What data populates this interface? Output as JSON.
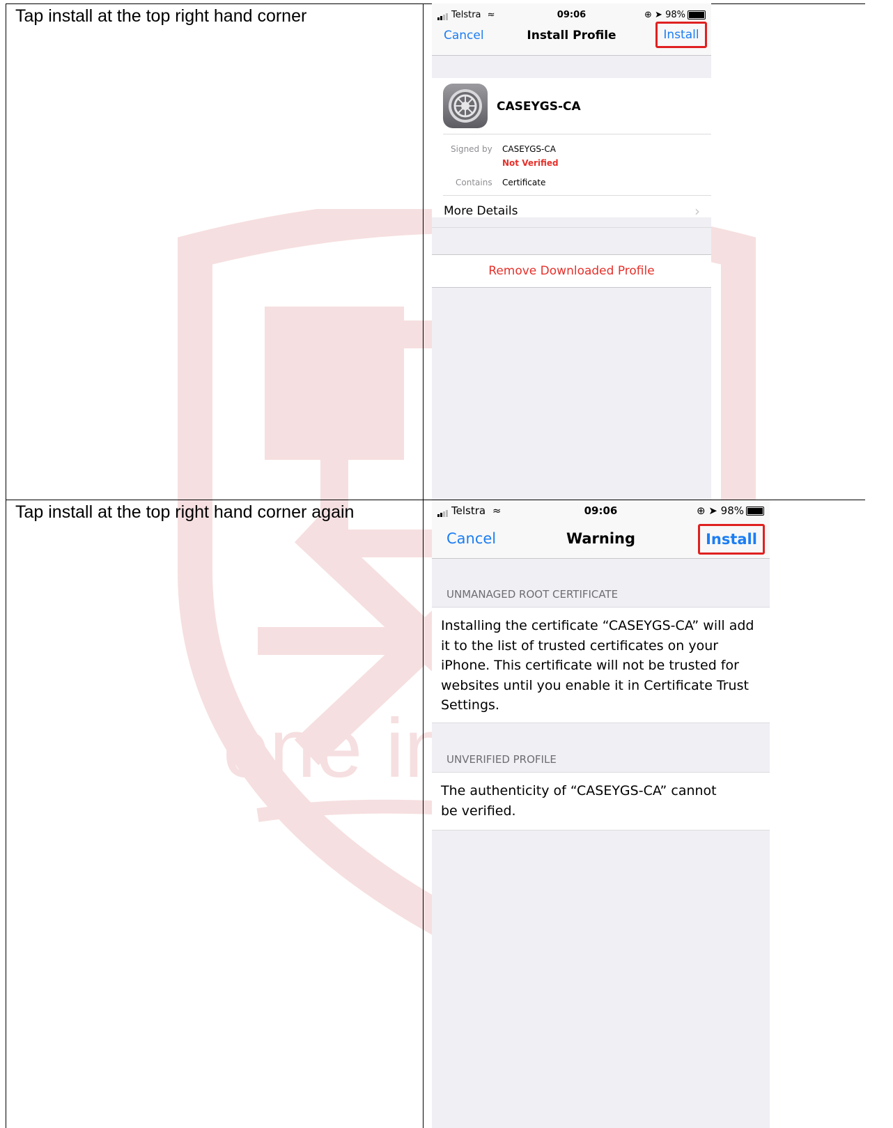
{
  "instructions": {
    "step1": "Tap install at the top right hand corner",
    "step2": "Tap install at the top right hand corner again"
  },
  "screen1": {
    "status": {
      "carrier": "Telstra",
      "time": "09:06",
      "battery": "98%"
    },
    "nav": {
      "cancel": "Cancel",
      "title": "Install Profile",
      "install": "Install"
    },
    "profile": {
      "name": "CASEYGS-CA",
      "signed_by_label": "Signed by",
      "signed_by_value": "CASEYGS-CA",
      "verification": "Not Verified",
      "contains_label": "Contains",
      "contains_value": "Certificate",
      "more_details": "More Details"
    },
    "remove": "Remove Downloaded Profile"
  },
  "screen2": {
    "status": {
      "carrier": "Telstra",
      "time": "09:06",
      "battery": "98%"
    },
    "nav": {
      "cancel": "Cancel",
      "title": "Warning",
      "install": "Install"
    },
    "section1_header": "UNMANAGED ROOT CERTIFICATE",
    "section1_text": "Installing the certificate “CASEYGS-CA” will add it to the list of trusted certificates on your iPhone. This certificate will not be trusted for websites until you enable it in Certificate Trust Settings.",
    "section2_header": "UNVERIFIED PROFILE",
    "section2_text": "The authenticity of “CASEYGS-CA” cannot be verified."
  },
  "watermark": {
    "text": "one in"
  },
  "colors": {
    "ios_blue": "#1b7df3",
    "highlight_red": "#e02020",
    "destructive_red": "#e6302a",
    "watermark_red": "#c0141c"
  }
}
